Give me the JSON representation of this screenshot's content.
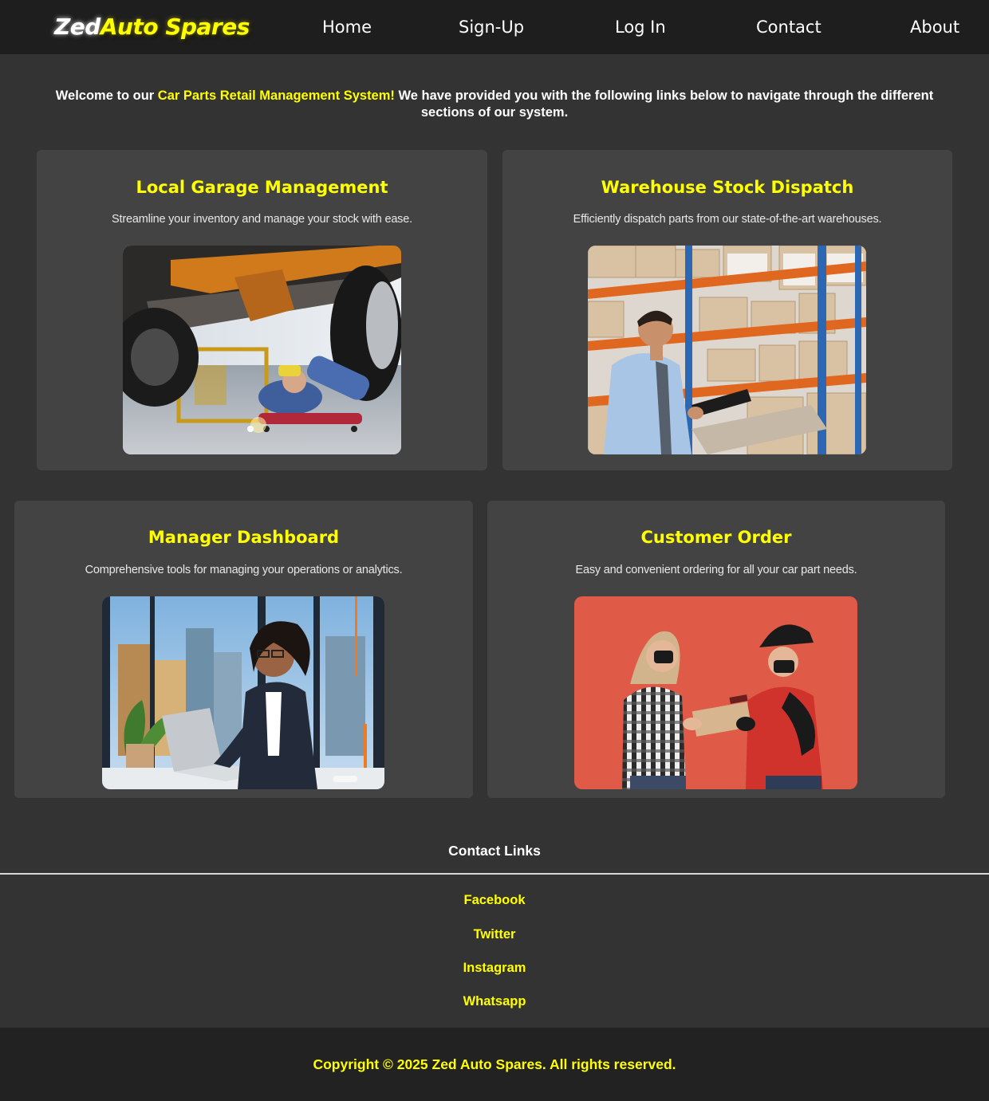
{
  "header": {
    "logo_part1": "Zed",
    "logo_part2": "Auto Spares",
    "nav": {
      "home": "Home",
      "signup": "Sign-Up",
      "login": "Log In",
      "contact": "Contact",
      "about": "About"
    }
  },
  "intro": {
    "prefix": "Welcome to our ",
    "highlight": "Car Parts Retail Management System!",
    "suffix": " We have provided you with the following links below to navigate through the different sections of our system."
  },
  "cards": [
    {
      "title": "Local Garage Management",
      "description": "Streamline your inventory and manage your stock with ease.",
      "image": "mechanic-under-car-photo"
    },
    {
      "title": "Warehouse Stock Dispatch",
      "description": "Efficiently dispatch parts from our state-of-the-art warehouses.",
      "image": "warehouse-worker-photo"
    },
    {
      "title": "Manager Dashboard",
      "description": "Comprehensive tools for managing your operations or analytics.",
      "image": "manager-at-laptop-photo"
    },
    {
      "title": "Customer Order",
      "description": "Easy and convenient ordering for all your car part needs.",
      "image": "package-delivery-photo"
    }
  ],
  "contact": {
    "heading": "Contact Links",
    "links": [
      "Facebook",
      "Twitter",
      "Instagram",
      "Whatsapp"
    ]
  },
  "footer": {
    "copyright": "Copyright © 2025 Zed Auto Spares. All rights reserved."
  },
  "colors": {
    "page_bg": "#333333",
    "navbar_bg": "#1e1e1e",
    "card_bg": "#434343",
    "footer_bg": "#222222",
    "accent": "#ffff00",
    "text": "#ffffff"
  }
}
